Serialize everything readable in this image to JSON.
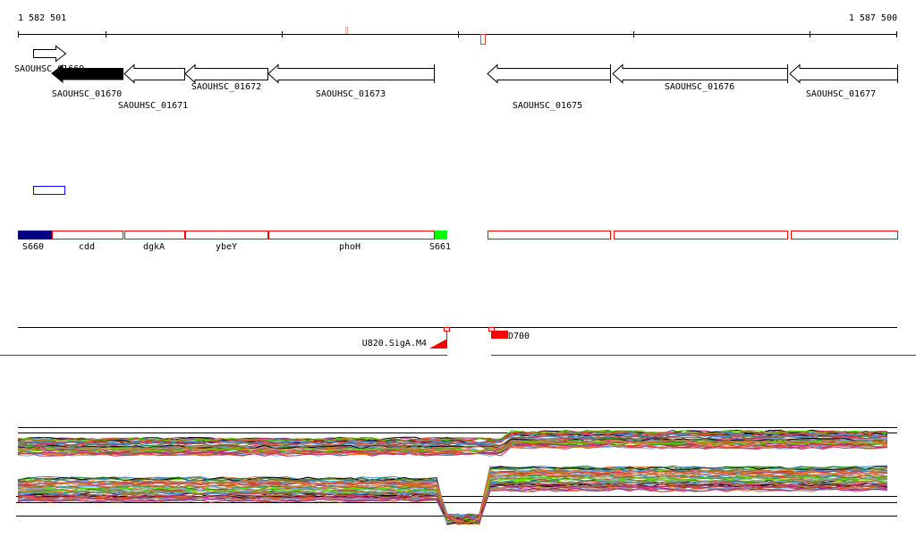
{
  "scale": {
    "start_label": "1 582 501",
    "end_label": "1 587 500"
  },
  "genes": [
    {
      "id": "SAOUHSC_01669",
      "strand": "+",
      "style": "outline"
    },
    {
      "id": "SAOUHSC_01670",
      "strand": "-",
      "style": "filled"
    },
    {
      "id": "SAOUHSC_01671",
      "strand": "-",
      "style": "outline"
    },
    {
      "id": "SAOUHSC_01672",
      "strand": "-",
      "style": "outline"
    },
    {
      "id": "SAOUHSC_01673",
      "strand": "-",
      "style": "outline"
    },
    {
      "id": "SAOUHSC_01675",
      "strand": "-",
      "style": "outline"
    },
    {
      "id": "SAOUHSC_01676",
      "strand": "-",
      "style": "outline"
    },
    {
      "id": "SAOUHSC_01677",
      "strand": "-",
      "style": "outline"
    }
  ],
  "segments": [
    {
      "label": "S660",
      "color": "#000080"
    },
    {
      "label": "cdd",
      "color": "#ff0000"
    },
    {
      "label": "dgkA",
      "color": "#ff0000"
    },
    {
      "label": "ybeY",
      "color": "#ff0000"
    },
    {
      "label": "phoH",
      "color": "#ff0000"
    },
    {
      "label": "S661",
      "color": "#00ff00"
    }
  ],
  "features": {
    "promoter_label": "U820.SigA.M4",
    "downstream_label": "D700"
  },
  "colors": {
    "accent": "#ff0000",
    "segment_blue": "#000080",
    "segment_green": "#00ff00"
  }
}
